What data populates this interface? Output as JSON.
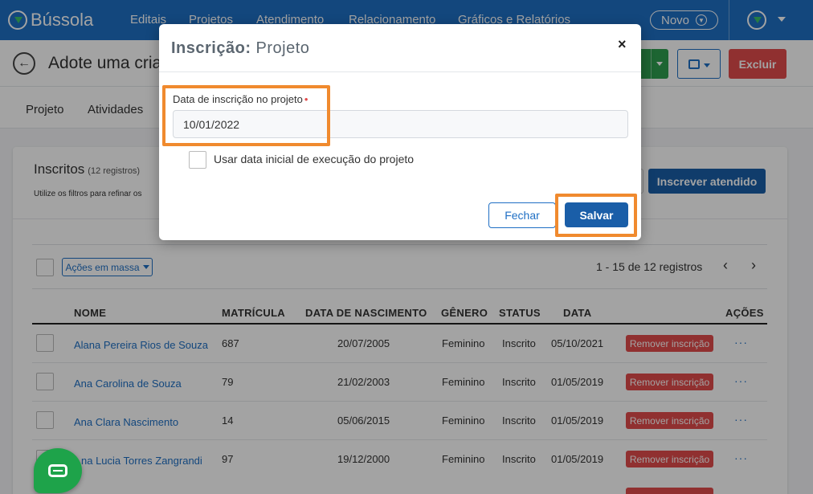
{
  "app": {
    "logo_text": "Bússola",
    "nav": [
      "Editais",
      "Projetos",
      "Atendimento",
      "Relacionamento",
      "Gráficos e Relatórios"
    ],
    "novo_label": "Novo"
  },
  "header": {
    "title": "Adote uma cria",
    "excluir_label": "Excluir"
  },
  "tabs": [
    "Projeto",
    "Atividades"
  ],
  "inscritos": {
    "title": "Inscritos",
    "count": "(12 registros)",
    "hint": "Utilize os filtros para refinar os",
    "inscrever_label": "Inscrever atendido",
    "acoes_massa_label": "Ações em massa",
    "pagination": "1 - 15 de 12 registros",
    "prev_icon": "‹",
    "next_icon": "›"
  },
  "table": {
    "columns": [
      "NOME",
      "MATRÍCULA",
      "DATA DE NASCIMENTO",
      "GÊNERO",
      "STATUS",
      "DATA",
      "AÇÕES"
    ],
    "rows": [
      {
        "nome": "Alana Pereira Rios de Souza",
        "matricula": "687",
        "nascimento": "20/07/2005",
        "genero": "Feminino",
        "status": "Inscrito",
        "data": "05/10/2021",
        "action": "Remover inscrição",
        "more": "···"
      },
      {
        "nome": "Ana Carolina de Souza",
        "matricula": "79",
        "nascimento": "21/02/2003",
        "genero": "Feminino",
        "status": "Inscrito",
        "data": "01/05/2019",
        "action": "Remover inscrição",
        "more": "···"
      },
      {
        "nome": "Ana Clara Nascimento",
        "matricula": "14",
        "nascimento": "05/06/2015",
        "genero": "Feminino",
        "status": "Inscrito",
        "data": "01/05/2019",
        "action": "Remover inscrição",
        "more": "···"
      },
      {
        "nome": "na Lucia Torres Zangrandi",
        "matricula": "97",
        "nascimento": "19/12/2000",
        "genero": "Feminino",
        "status": "Inscrito",
        "data": "01/05/2019",
        "action": "Remover inscrição",
        "more": "···"
      }
    ]
  },
  "modal": {
    "title_bold": "Inscrição:",
    "title_rest": "Projeto",
    "close": "×",
    "date_label": "Data de inscrição no projeto",
    "required_mark": "•",
    "date_value": "10/01/2022",
    "checkbox_label": "Usar data inicial de execução do projeto",
    "fechar_label": "Fechar",
    "salvar_label": "Salvar"
  },
  "colors": {
    "primary": "#1f6fc4",
    "danger": "#e24b4b",
    "highlight": "#f08a2e",
    "success": "#2e9e4f"
  }
}
